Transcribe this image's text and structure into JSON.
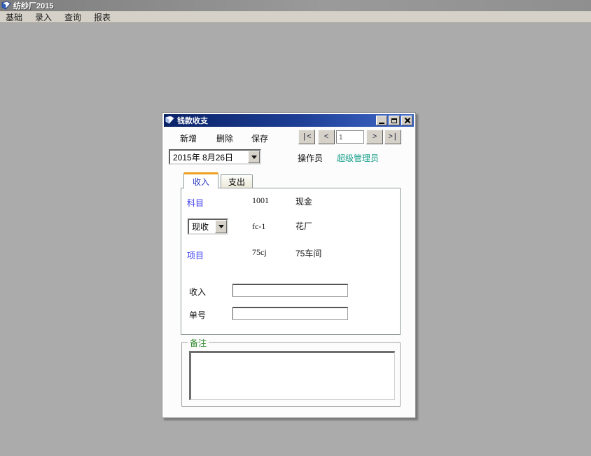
{
  "app": {
    "title": "纺纱厂2015",
    "menu": [
      {
        "label": "基础"
      },
      {
        "label": "录入"
      },
      {
        "label": "查询"
      },
      {
        "label": "报表"
      }
    ]
  },
  "dialog": {
    "title": "钱款收支",
    "toolbar": {
      "new_label": "新增",
      "delete_label": "删除",
      "save_label": "保存"
    },
    "nav": {
      "first": "|<",
      "prev": "<",
      "record_value": "1",
      "next": ">",
      "last": ">|"
    },
    "date_value": "2015年 8月26日",
    "operator_label": "操作员",
    "operator_value": "超级管理员",
    "tabs": [
      {
        "label": "收入",
        "active": true
      },
      {
        "label": "支出",
        "active": false
      }
    ],
    "form": {
      "subject_label": "科目",
      "subject_code": "1001",
      "subject_name": "现金",
      "method_value": "现收",
      "method_code": "fc-1",
      "method_name": "花厂",
      "project_label": "项目",
      "project_code": "75cj",
      "project_name": "75车间",
      "income_label": "收入",
      "income_value": "",
      "billno_label": "单号",
      "billno_value": ""
    },
    "remarks": {
      "label": "备注",
      "value": ""
    }
  },
  "icons": {
    "app_icon": "document-icon",
    "dialog_icon": "document-icon",
    "window_buttons": [
      "minimize-icon",
      "maximize-icon",
      "close-icon"
    ],
    "dropdown_arrows": "dropdown-arrow-icon"
  },
  "colors": {
    "desktop_bg": "#ababab",
    "menubar_bg": "#d5d1c8",
    "app_titlebar_inactive": "#8a8a8a",
    "dialog_titlebar_start": "#0a2266",
    "dialog_titlebar_end": "#4169c8",
    "label_blue": "#3c3cf0",
    "operator_teal": "#17a08c",
    "remarks_green": "#2e8b2e",
    "tab_active_stripe": "#efa01e",
    "tab_active_text": "#2b3bbf"
  }
}
